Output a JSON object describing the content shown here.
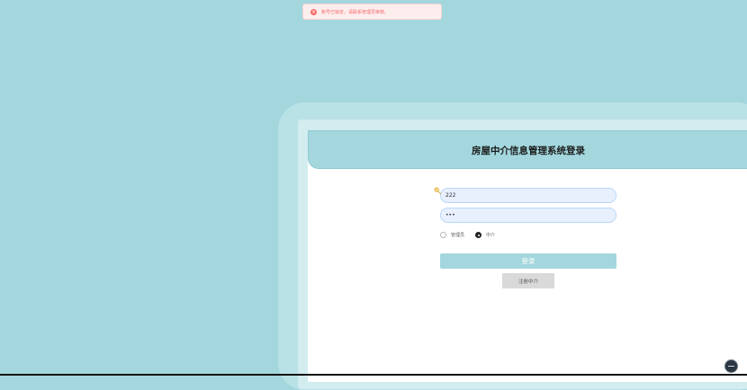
{
  "toast": {
    "message": "账号已锁定，请联系管理员审核。",
    "icon": "error-circle-icon",
    "color": "#f56c6c"
  },
  "login": {
    "title": "房屋中介信息管理系统登录",
    "username_value": "222",
    "password_value": "111",
    "roles": [
      {
        "label": "管理员",
        "selected": false
      },
      {
        "label": "中介",
        "selected": true
      }
    ],
    "login_label": "登录",
    "register_label": "注册中介"
  },
  "theme": {
    "accent": "#a3d7dd",
    "card": "#ffffff"
  }
}
